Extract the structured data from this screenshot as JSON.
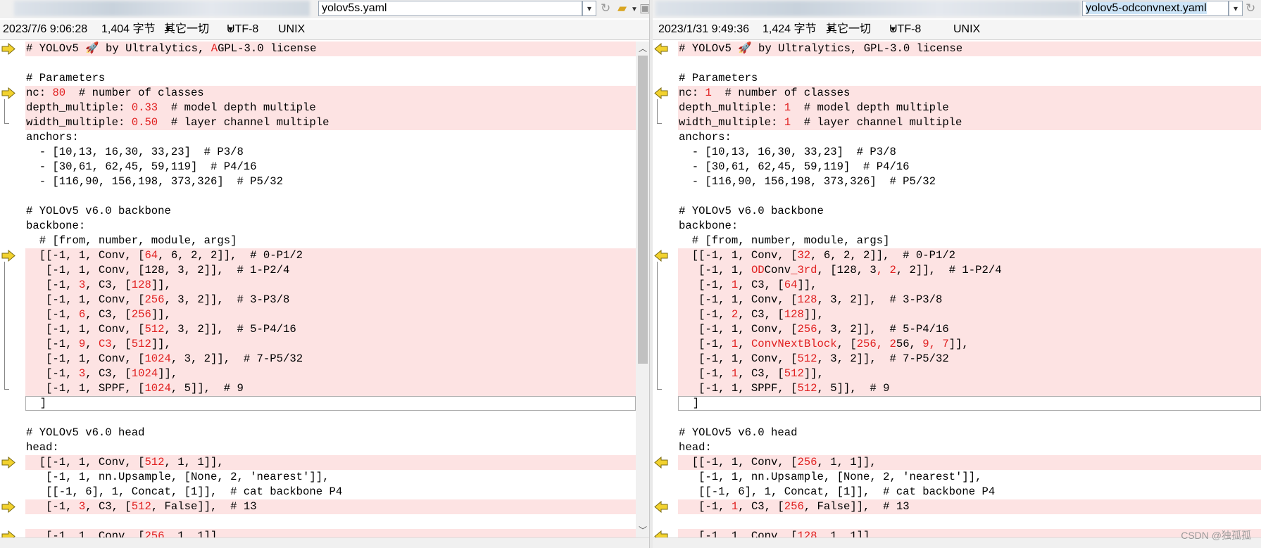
{
  "left": {
    "path": "yolov5s.yaml",
    "info": {
      "date": "2023/7/6 9:06:28",
      "size": "1,404 字节",
      "filter": "其它一切",
      "encoding": "UTF-8",
      "eol": "UNIX"
    },
    "lines": [
      {
        "segs": [
          [
            "# YOLOv5 🚀 by Ultralytics, ",
            0
          ],
          [
            "A",
            1
          ],
          [
            "GPL-3.0 license",
            0
          ]
        ],
        "diff": true,
        "arrow": true
      },
      {
        "segs": [
          [
            "",
            0
          ]
        ]
      },
      {
        "segs": [
          [
            "# Parameters",
            0
          ]
        ]
      },
      {
        "segs": [
          [
            "nc: ",
            0
          ],
          [
            "80",
            1
          ],
          [
            "  # number of classes",
            0
          ]
        ],
        "diff": true,
        "arrow": true
      },
      {
        "segs": [
          [
            "depth_multiple: ",
            0
          ],
          [
            "0.33",
            1
          ],
          [
            "  # model depth multiple",
            0
          ]
        ],
        "diff": true
      },
      {
        "segs": [
          [
            "width_multiple: ",
            0
          ],
          [
            "0.50",
            1
          ],
          [
            "  # layer channel multiple",
            0
          ]
        ],
        "diff": true
      },
      {
        "segs": [
          [
            "anchors:",
            0
          ]
        ]
      },
      {
        "segs": [
          [
            "  - [10,13, 16,30, 33,23]  # P3/8",
            0
          ]
        ]
      },
      {
        "segs": [
          [
            "  - [30,61, 62,45, 59,119]  # P4/16",
            0
          ]
        ]
      },
      {
        "segs": [
          [
            "  - [116,90, 156,198, 373,326]  # P5/32",
            0
          ]
        ]
      },
      {
        "segs": [
          [
            "",
            0
          ]
        ]
      },
      {
        "segs": [
          [
            "# YOLOv5 v6.0 backbone",
            0
          ]
        ]
      },
      {
        "segs": [
          [
            "backbone:",
            0
          ]
        ]
      },
      {
        "segs": [
          [
            "  # [from, number, module, args]",
            0
          ]
        ]
      },
      {
        "segs": [
          [
            "  [[-1, 1, Conv, [",
            0
          ],
          [
            "64",
            1
          ],
          [
            ", 6, 2, 2]],  # 0-P1/2",
            0
          ]
        ],
        "diff": true,
        "arrow": true
      },
      {
        "segs": [
          [
            "   [-1, 1, Conv, [128, 3, 2]],  # 1-P2/4",
            0
          ]
        ],
        "diff": true
      },
      {
        "segs": [
          [
            "   [-1, ",
            0
          ],
          [
            "3",
            1
          ],
          [
            ", C3, [",
            0
          ],
          [
            "128",
            1
          ],
          [
            "]],",
            0
          ]
        ],
        "diff": true
      },
      {
        "segs": [
          [
            "   [-1, 1, Conv, [",
            0
          ],
          [
            "256",
            1
          ],
          [
            ", 3, 2]],  # 3-P3/8",
            0
          ]
        ],
        "diff": true
      },
      {
        "segs": [
          [
            "   [-1, ",
            0
          ],
          [
            "6",
            1
          ],
          [
            ", C3, [",
            0
          ],
          [
            "256",
            1
          ],
          [
            "]],",
            0
          ]
        ],
        "diff": true
      },
      {
        "segs": [
          [
            "   [-1, 1, Conv, [",
            0
          ],
          [
            "512",
            1
          ],
          [
            ", 3, 2]],  # 5-P4/16",
            0
          ]
        ],
        "diff": true
      },
      {
        "segs": [
          [
            "   [-1, ",
            0
          ],
          [
            "9",
            1
          ],
          [
            ", ",
            0
          ],
          [
            "C3",
            1
          ],
          [
            ", [",
            0
          ],
          [
            "512",
            1
          ],
          [
            "]],",
            0
          ]
        ],
        "diff": true
      },
      {
        "segs": [
          [
            "   [-1, 1, Conv, [",
            0
          ],
          [
            "1024",
            1
          ],
          [
            ", 3, 2]],  # 7-P5/32",
            0
          ]
        ],
        "diff": true
      },
      {
        "segs": [
          [
            "   [-1, ",
            0
          ],
          [
            "3",
            1
          ],
          [
            ", C3, [",
            0
          ],
          [
            "1024",
            1
          ],
          [
            "]],",
            0
          ]
        ],
        "diff": true
      },
      {
        "segs": [
          [
            "   [-1, 1, SPPF, [",
            0
          ],
          [
            "1024",
            1
          ],
          [
            ", 5]],  # 9",
            0
          ]
        ],
        "diff": true
      },
      {
        "segs": [
          [
            "  ]",
            0
          ]
        ],
        "boxed": true
      },
      {
        "segs": [
          [
            "",
            0
          ]
        ]
      },
      {
        "segs": [
          [
            "# YOLOv5 v6.0 head",
            0
          ]
        ]
      },
      {
        "segs": [
          [
            "head:",
            0
          ]
        ]
      },
      {
        "segs": [
          [
            "  [[-1, 1, Conv, [",
            0
          ],
          [
            "512",
            1
          ],
          [
            ", 1, 1]],",
            0
          ]
        ],
        "diff": true,
        "arrow": true
      },
      {
        "segs": [
          [
            "   [-1, 1, nn.Upsample, [None, 2, 'nearest']],",
            0
          ]
        ]
      },
      {
        "segs": [
          [
            "   [[-1, 6], 1, Concat, [1]],  # cat backbone P4",
            0
          ]
        ]
      },
      {
        "segs": [
          [
            "   [-1, ",
            0
          ],
          [
            "3",
            1
          ],
          [
            ", C3, [",
            0
          ],
          [
            "512",
            1
          ],
          [
            ", False]],  # 13",
            0
          ]
        ],
        "diff": true,
        "arrow": true
      },
      {
        "segs": [
          [
            "",
            0
          ]
        ]
      },
      {
        "segs": [
          [
            "   [-1, 1, Conv, [",
            0
          ],
          [
            "256",
            1
          ],
          [
            ", 1, 1]],",
            0
          ]
        ],
        "diff": true,
        "arrow": true
      }
    ]
  },
  "right": {
    "path": "yolov5-odconvnext.yaml",
    "info": {
      "date": "2023/1/31 9:49:36",
      "size": "1,424 字节",
      "filter": "其它一切",
      "encoding": "UTF-8",
      "eol": "UNIX"
    },
    "lines": [
      {
        "segs": [
          [
            "# YOLOv5 🚀 by Ultralytics, GPL-3.0 license",
            0
          ]
        ],
        "diff": true,
        "arrow": true
      },
      {
        "segs": [
          [
            "",
            0
          ]
        ]
      },
      {
        "segs": [
          [
            "# Parameters",
            0
          ]
        ]
      },
      {
        "segs": [
          [
            "nc: ",
            0
          ],
          [
            "1",
            1
          ],
          [
            "  # number of classes",
            0
          ]
        ],
        "diff": true,
        "arrow": true
      },
      {
        "segs": [
          [
            "depth_multiple: ",
            0
          ],
          [
            "1",
            1
          ],
          [
            "  # model depth multiple",
            0
          ]
        ],
        "diff": true
      },
      {
        "segs": [
          [
            "width_multiple: ",
            0
          ],
          [
            "1",
            1
          ],
          [
            "  # layer channel multiple",
            0
          ]
        ],
        "diff": true
      },
      {
        "segs": [
          [
            "anchors:",
            0
          ]
        ]
      },
      {
        "segs": [
          [
            "  - [10,13, 16,30, 33,23]  # P3/8",
            0
          ]
        ]
      },
      {
        "segs": [
          [
            "  - [30,61, 62,45, 59,119]  # P4/16",
            0
          ]
        ]
      },
      {
        "segs": [
          [
            "  - [116,90, 156,198, 373,326]  # P5/32",
            0
          ]
        ]
      },
      {
        "segs": [
          [
            "",
            0
          ]
        ]
      },
      {
        "segs": [
          [
            "# YOLOv5 v6.0 backbone",
            0
          ]
        ]
      },
      {
        "segs": [
          [
            "backbone:",
            0
          ]
        ]
      },
      {
        "segs": [
          [
            "  # [from, number, module, args]",
            0
          ]
        ]
      },
      {
        "segs": [
          [
            "  [[-1, 1, Conv, [",
            0
          ],
          [
            "32",
            1
          ],
          [
            ", 6, 2, 2]],  # 0-P1/2",
            0
          ]
        ],
        "diff": true,
        "arrow": true
      },
      {
        "segs": [
          [
            "   [-1, 1, ",
            0
          ],
          [
            "OD",
            1
          ],
          [
            "Conv",
            0
          ],
          [
            "_3rd",
            1
          ],
          [
            ", [128, 3",
            0
          ],
          [
            ", 2",
            1
          ],
          [
            ", 2]],  # 1-P2/4",
            0
          ]
        ],
        "diff": true
      },
      {
        "segs": [
          [
            "   [-1, ",
            0
          ],
          [
            "1",
            1
          ],
          [
            ", C3, [",
            0
          ],
          [
            "64",
            1
          ],
          [
            "]],",
            0
          ]
        ],
        "diff": true
      },
      {
        "segs": [
          [
            "   [-1, 1, Conv, [",
            0
          ],
          [
            "128",
            1
          ],
          [
            ", 3, 2]],  # 3-P3/8",
            0
          ]
        ],
        "diff": true
      },
      {
        "segs": [
          [
            "   [-1, ",
            0
          ],
          [
            "2",
            1
          ],
          [
            ", C3, [",
            0
          ],
          [
            "128",
            1
          ],
          [
            "]],",
            0
          ]
        ],
        "diff": true
      },
      {
        "segs": [
          [
            "   [-1, 1, Conv, [",
            0
          ],
          [
            "256",
            1
          ],
          [
            ", 3, 2]],  # 5-P4/16",
            0
          ]
        ],
        "diff": true
      },
      {
        "segs": [
          [
            "   [-1, ",
            0
          ],
          [
            "1",
            1
          ],
          [
            ", ",
            0
          ],
          [
            "ConvNextBlock",
            1
          ],
          [
            ", [",
            0
          ],
          [
            "256, 2",
            1
          ],
          [
            "56, ",
            0
          ],
          [
            "9, 7",
            1
          ],
          [
            "]],",
            0
          ]
        ],
        "diff": true
      },
      {
        "segs": [
          [
            "   [-1, 1, Conv, [",
            0
          ],
          [
            "512",
            1
          ],
          [
            ", 3, 2]],  # 7-P5/32",
            0
          ]
        ],
        "diff": true
      },
      {
        "segs": [
          [
            "   [-1, ",
            0
          ],
          [
            "1",
            1
          ],
          [
            ", C3, [",
            0
          ],
          [
            "512",
            1
          ],
          [
            "]],",
            0
          ]
        ],
        "diff": true
      },
      {
        "segs": [
          [
            "   [-1, 1, SPPF, [",
            0
          ],
          [
            "512",
            1
          ],
          [
            ", 5]],  # 9",
            0
          ]
        ],
        "diff": true
      },
      {
        "segs": [
          [
            "  ]",
            0
          ]
        ],
        "boxed": true
      },
      {
        "segs": [
          [
            "",
            0
          ]
        ]
      },
      {
        "segs": [
          [
            "# YOLOv5 v6.0 head",
            0
          ]
        ]
      },
      {
        "segs": [
          [
            "head:",
            0
          ]
        ]
      },
      {
        "segs": [
          [
            "  [[-1, 1, Conv, [",
            0
          ],
          [
            "256",
            1
          ],
          [
            ", 1, 1]],",
            0
          ]
        ],
        "diff": true,
        "arrow": true
      },
      {
        "segs": [
          [
            "   [-1, 1, nn.Upsample, [None, 2, 'nearest']],",
            0
          ]
        ]
      },
      {
        "segs": [
          [
            "   [[-1, 6], 1, Concat, [1]],  # cat backbone P4",
            0
          ]
        ]
      },
      {
        "segs": [
          [
            "   [-1, ",
            0
          ],
          [
            "1",
            1
          ],
          [
            ", C3, [",
            0
          ],
          [
            "256",
            1
          ],
          [
            ", False]],  # 13",
            0
          ]
        ],
        "diff": true,
        "arrow": true
      },
      {
        "segs": [
          [
            "",
            0
          ]
        ]
      },
      {
        "segs": [
          [
            "   [-1, 1, Conv, [",
            0
          ],
          [
            "128",
            1
          ],
          [
            ", 1, 1]],",
            0
          ]
        ],
        "diff": true,
        "arrow": true
      }
    ]
  },
  "watermark": "CSDN @独孤孤",
  "icons": {
    "dropdown": "chevron-down-icon",
    "refresh": "refresh-icon",
    "folder": "folder-open-icon",
    "save": "save-icon",
    "diff_arrow": "arrow-right-icon"
  },
  "colors": {
    "diff_bg": "#fde3e3",
    "diff_text": "#e02020",
    "arrow": "#f2d22e"
  }
}
